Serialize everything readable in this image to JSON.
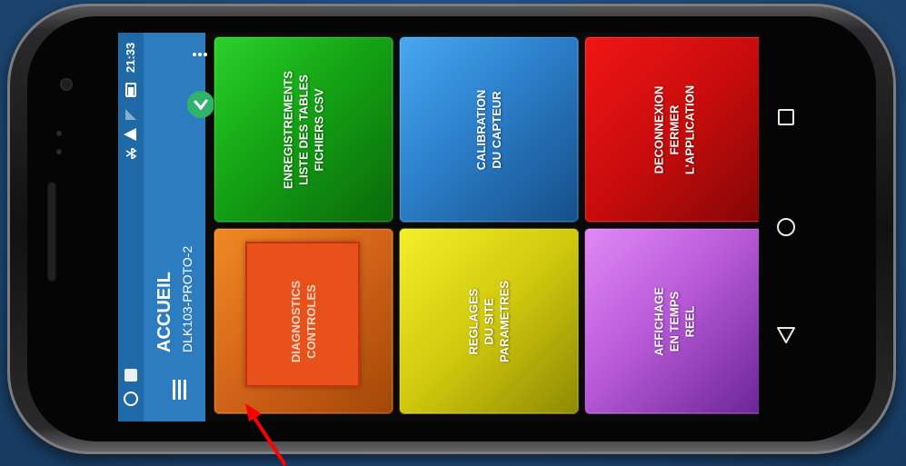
{
  "status": {
    "time": "21:33"
  },
  "appbar": {
    "title": "ACCUEIL",
    "subtitle": "DLK103-PROTO-2"
  },
  "tiles": [
    {
      "label": "ENREGISTREMENTS\nLISTE DES TABLES\nFICHIERS CSV",
      "color": "#1f9a1f"
    },
    {
      "label": "CALIBRATION\nDU CAPTEUR",
      "color": "#2a7dc4"
    },
    {
      "label": "DECONNEXION\nFERMER L'APPLICATION",
      "color": "#c51010"
    },
    {
      "label": "DIAGNOSTICS\nCONTROLES",
      "color": "#e25a10"
    },
    {
      "label": "REGLAGES\nDU SITE\nPARAMETRES",
      "color": "#c7c10a"
    },
    {
      "label": "AFFICHAGE\nEN TEMPS REEL",
      "color": "#b14fd0"
    }
  ],
  "icons": {
    "menu": "hamburger-menu-icon",
    "more": "overflow-more-icon",
    "ok": "check-circle-icon",
    "back": "nav-back-icon",
    "home": "nav-home-icon",
    "recents": "nav-recents-icon"
  }
}
